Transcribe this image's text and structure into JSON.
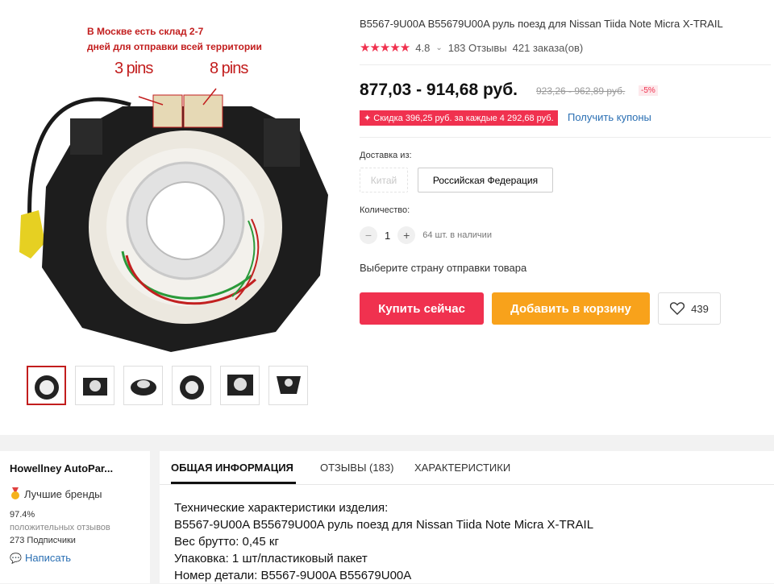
{
  "image": {
    "overlay_note_line1": "В Москве есть склад 2-7",
    "overlay_note_line2": "дней для отправки всей территории",
    "pin_label_left": "3 pins",
    "pin_label_right": "8 pins",
    "watermark": "Howellney"
  },
  "thumbnails": [
    "thumb-1",
    "thumb-2",
    "thumb-3",
    "thumb-4",
    "thumb-5",
    "thumb-6"
  ],
  "product": {
    "title": "B5567-9U00A B55679U00A руль поезд для Nissan Tiida Note Micra X-TRAIL",
    "rating": "4.8",
    "reviews": "183 Отзывы",
    "orders": "421 заказа(ов)",
    "price": "877,03 - 914,68 руб.",
    "old_price": "923,26 - 962,89 руб.",
    "discount": "-5%",
    "promo": "✦ Скидка 396,25 руб. за каждые 4 292,68 руб.",
    "coupons": "Получить купоны"
  },
  "shipping": {
    "label": "Доставка из:",
    "option_1": "Китай",
    "option_2": "Российская Федерация"
  },
  "quantity": {
    "label": "Количество:",
    "minus": "−",
    "value": "1",
    "plus": "+",
    "stock": "64 шт. в наличии"
  },
  "choose_country": "Выберите страну отправки товара",
  "actions": {
    "buy": "Купить сейчас",
    "cart": "Добавить в корзину",
    "wishlist_count": "439"
  },
  "store": {
    "name": "Howellney AutoPar...",
    "badge": "Лучшие бренды",
    "positive_pct": "97.4%",
    "positive_label": "положительных отзывов",
    "subscribers": "273 Подписчики",
    "write": "Написать"
  },
  "tabs": {
    "general": "ОБЩАЯ ИНФОРМАЦИЯ",
    "reviews": "ОТЗЫВЫ (183)",
    "specs": "ХАРАКТЕРИСТИКИ"
  },
  "description": {
    "line1": "Технические характеристики изделия:",
    "line2": "B5567-9U00A B55679U00A руль поезд для Nissan Tiida Note Micra X-TRAIL",
    "line3": "Вес брутто: 0,45 кг",
    "line4": "Упаковка: 1 шт/пластиковый пакет",
    "line5": "Номер детали: B5567-9U00A B55679U00A"
  },
  "colors": {
    "accent_red": "#f0314f",
    "accent_orange": "#f8a21b",
    "link_blue": "#2a6fb3"
  }
}
